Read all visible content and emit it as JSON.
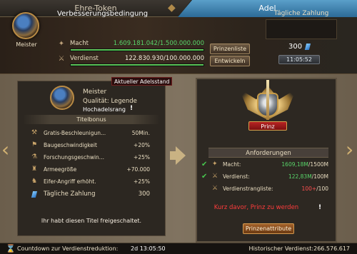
{
  "tabs": {
    "left": "Ehre-Token",
    "right": "Adel"
  },
  "top": {
    "rank_label": "Meister",
    "condition_title": "Verbesserungsbedingung",
    "power": {
      "label": "Macht",
      "value": "1.609.181.042/1.500.000.000",
      "progress": 1.0
    },
    "merit": {
      "label": "Verdienst",
      "value": "122.830.930/100.000.000",
      "progress": 1.0
    },
    "btn_prince_list": "Prinzenliste",
    "btn_develop": "Entwickeln",
    "daily_title": "Tägliche Zahlung",
    "daily_value": "300",
    "timer": "11:05:52"
  },
  "left_panel": {
    "current_tag": "Aktueller Adelsstand",
    "name": "Meister",
    "quality": "Qualität: Legende",
    "rank": "Hochadelsrang",
    "bonus_header": "Titelbonus",
    "bonuses": [
      {
        "icon": "hammer-icon",
        "label": "Gratis-Beschleunigun...",
        "value": "50Min."
      },
      {
        "icon": "boot-icon",
        "label": "Baugeschwindigkeit",
        "value": "+20%"
      },
      {
        "icon": "flask-icon",
        "label": "Forschungsgeschwin...",
        "value": "+25%"
      },
      {
        "icon": "soldier-icon",
        "label": "Armeegröße",
        "value": "+70.000"
      },
      {
        "icon": "horse-icon",
        "label": "Eifer-Angriff erhöht.",
        "value": "+25%"
      }
    ],
    "daily_label": "Tägliche Zahlung",
    "daily_value": "300",
    "unlocked_text": "Ihr habt diesen Titel freigeschaltet."
  },
  "right_panel": {
    "title_name": "Prinz",
    "req_header": "Anforderungen",
    "requirements": [
      {
        "met": true,
        "label": "Macht:",
        "value": "1609,18M",
        "target": "/1500M"
      },
      {
        "met": true,
        "label": "Verdienst:",
        "value": "122,83M",
        "target": "/100M"
      },
      {
        "met": false,
        "label": "Verdienstrangliste:",
        "value": "100+",
        "target": "/100"
      }
    ],
    "soon_text": "Kurz davor, Prinz zu werden",
    "btn_attributes": "Prinzenattribute"
  },
  "bottom": {
    "countdown_label": "Countdown zur Verdienstreduktion:",
    "countdown_value": "2d 13:05:50",
    "history_label": "Historischer Verdienst:266.576.617"
  },
  "colors": {
    "tab_active": "#3f83b4",
    "progress": "#3fbf4a",
    "negative": "#ff4f4f"
  }
}
